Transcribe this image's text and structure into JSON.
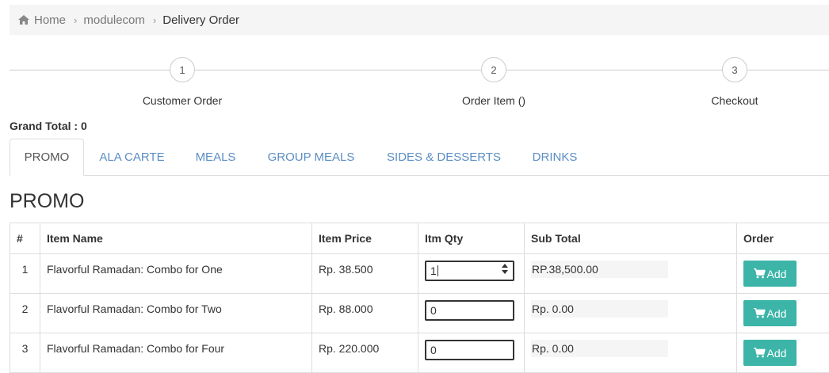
{
  "breadcrumb": {
    "home": "Home",
    "module": "modulecom",
    "current": "Delivery Order"
  },
  "stepper": {
    "steps": [
      {
        "number": "1",
        "label": "Customer Order"
      },
      {
        "number": "2",
        "label": "Order Item ()"
      },
      {
        "number": "3",
        "label": "Checkout"
      }
    ]
  },
  "grand_total": {
    "label": "Grand Total :",
    "value": "0"
  },
  "tabs": [
    {
      "label": "PROMO",
      "active": true
    },
    {
      "label": "ALA CARTE",
      "active": false
    },
    {
      "label": "MEALS",
      "active": false
    },
    {
      "label": "GROUP MEALS",
      "active": false
    },
    {
      "label": "SIDES & DESSERTS",
      "active": false
    },
    {
      "label": "DRINKS",
      "active": false
    }
  ],
  "section": {
    "title": "PROMO"
  },
  "table": {
    "headers": [
      "#",
      "Item Name",
      "Item Price",
      "Itm Qty",
      "Sub Total",
      "Order"
    ],
    "rows": [
      {
        "num": "1",
        "name": "Flavorful Ramadan: Combo for One",
        "price": "Rp. 38.500",
        "qty": "1",
        "subtotal": "RP.38,500.00",
        "button": "Add"
      },
      {
        "num": "2",
        "name": "Flavorful Ramadan: Combo for Two",
        "price": "Rp. 88.000",
        "qty": "0",
        "subtotal": "Rp. 0.00",
        "button": "Add"
      },
      {
        "num": "3",
        "name": "Flavorful Ramadan: Combo for Four",
        "price": "Rp. 220.000",
        "qty": "0",
        "subtotal": "Rp. 0.00",
        "button": "Add"
      }
    ]
  },
  "colors": {
    "tab_link": "#5b8ec4",
    "add_button": "#3cb4a8"
  }
}
